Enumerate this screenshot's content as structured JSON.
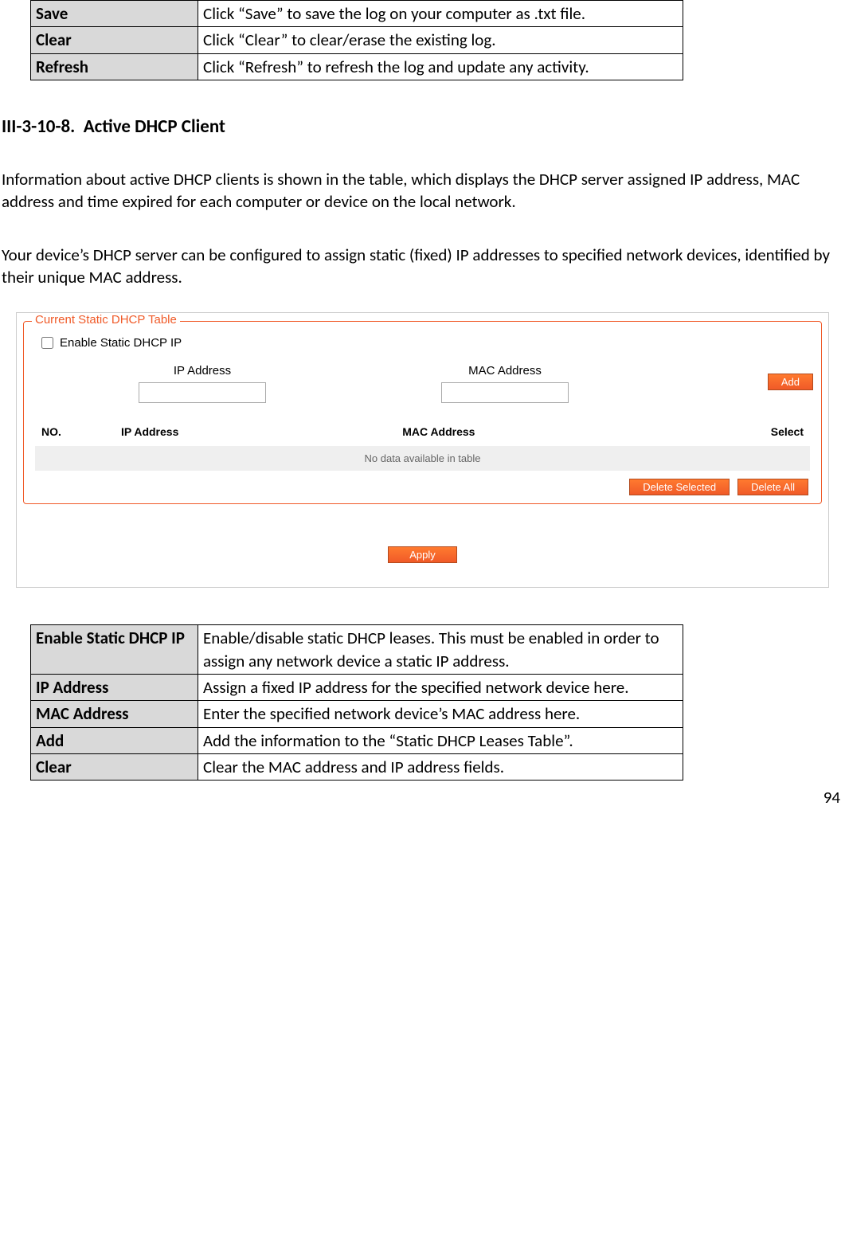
{
  "top_table": {
    "rows": [
      {
        "term": "Save",
        "desc": "Click “Save” to save the log on your computer as .txt file."
      },
      {
        "term": "Clear",
        "desc": "Click “Clear” to clear/erase the existing log."
      },
      {
        "term": "Refresh",
        "desc": "Click “Refresh” to refresh the log and update any activity."
      }
    ]
  },
  "section": {
    "heading": "III-3-10-8.  Active DHCP Client",
    "para1": "Information about active DHCP clients is shown in the table, which displays the DHCP server assigned IP address, MAC address and time expired for each computer or device on the local network.",
    "para2": "Your device’s DHCP server can be configured to assign static (fixed) IP addresses to specified network devices, identified by their unique MAC address."
  },
  "panel": {
    "legend": "Current Static DHCP Table",
    "enable_label": "Enable Static DHCP IP",
    "ip_label": "IP Address",
    "mac_label": "MAC Address",
    "add_btn": "Add",
    "headers": {
      "no": "NO.",
      "ip": "IP Address",
      "mac": "MAC Address",
      "select": "Select"
    },
    "empty": "No data available in table",
    "delete_selected": "Delete Selected",
    "delete_all": "Delete All",
    "apply": "Apply"
  },
  "bottom_table": {
    "rows": [
      {
        "term": "Enable Static DHCP IP",
        "desc": "Enable/disable static DHCP leases. This must be enabled in order to assign any network device a static IP address."
      },
      {
        "term": "IP Address",
        "desc": "Assign a fixed IP address for the specified network device here."
      },
      {
        "term": "MAC Address",
        "desc": "Enter the specified network device’s MAC address here."
      },
      {
        "term": "Add",
        "desc": "Add the information to the “Static DHCP Leases Table”."
      },
      {
        "term": "Clear",
        "desc": "Clear the MAC address and IP address fields."
      }
    ]
  },
  "page_number": "94"
}
